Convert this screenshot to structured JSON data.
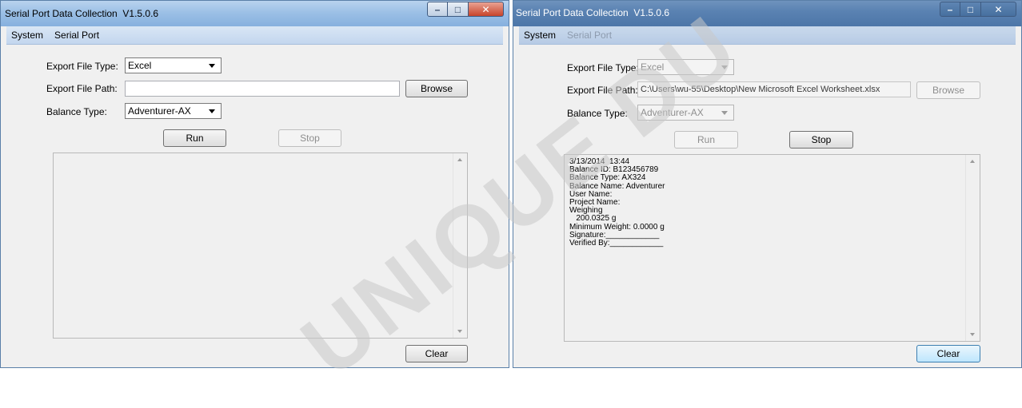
{
  "windows": [
    {
      "title": "Serial Port Data Collection  V1.5.0.6",
      "menu": [
        {
          "label": "System",
          "enabled": true
        },
        {
          "label": "Serial Port",
          "enabled": true
        }
      ],
      "export_file_type_label": "Export File Type:",
      "export_file_type_value": "Excel",
      "export_file_path_label": "Export File Path:",
      "export_file_path_value": "",
      "browse_label": "Browse",
      "balance_type_label": "Balance Type:",
      "balance_type_value": "Adventurer-AX",
      "run_label": "Run",
      "stop_label": "Stop",
      "output_lines": [],
      "clear_label": "Clear"
    },
    {
      "title": "Serial Port Data Collection  V1.5.0.6",
      "menu": [
        {
          "label": "System",
          "enabled": true
        },
        {
          "label": "Serial Port",
          "enabled": false
        }
      ],
      "export_file_type_label": "Export File Type:",
      "export_file_type_value": "Excel",
      "export_file_path_label": "Export File Path:",
      "export_file_path_value": "C:\\Users\\wu-55\\Desktop\\New Microsoft Excel Worksheet.xlsx",
      "browse_label": "Browse",
      "balance_type_label": "Balance Type:",
      "balance_type_value": "Adventurer-AX",
      "run_label": "Run",
      "stop_label": "Stop",
      "output_lines": [
        "3/13/2014  13:44",
        "Balance ID: B123456789",
        "Balance Type: AX324",
        "Balance Name: Adventurer",
        "User Name:",
        "Project Name:",
        "Weighing",
        "   200.0325 g",
        "Minimum Weight: 0.0000 g",
        "Signature:____________",
        "Verified By:____________"
      ],
      "clear_label": "Clear"
    }
  ],
  "watermark": "UNIQUE DU"
}
